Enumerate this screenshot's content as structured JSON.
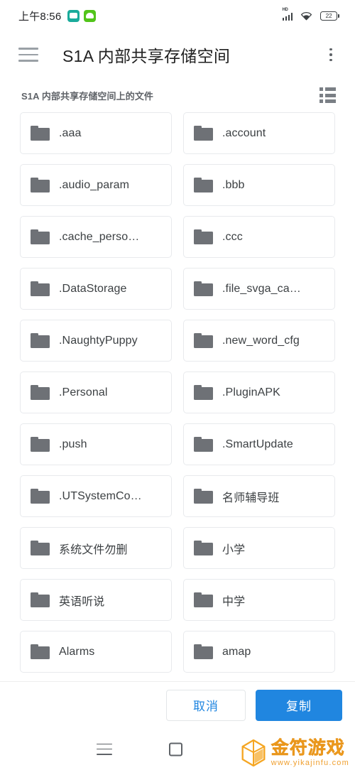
{
  "status_bar": {
    "time": "上午8:56",
    "app_icons": [
      "teal-app-icon",
      "green-app-icon"
    ],
    "network_label": "HD",
    "signal_icon": "signal-bars-icon",
    "wifi_icon": "wifi-icon",
    "battery_level": "22"
  },
  "app_bar": {
    "menu_icon": "hamburger-menu-icon",
    "title": "S1A 内部共享存储空间",
    "overflow_icon": "more-vertical-icon"
  },
  "sub_header": {
    "text": "S1A 内部共享存储空间上的文件",
    "view_toggle_icon": "list-view-icon"
  },
  "files": [
    {
      "name": ".aaa",
      "icon": "folder-icon"
    },
    {
      "name": ".account",
      "icon": "folder-icon"
    },
    {
      "name": ".audio_param",
      "icon": "folder-icon"
    },
    {
      "name": ".bbb",
      "icon": "folder-icon"
    },
    {
      "name": ".cache_perso…",
      "icon": "folder-icon"
    },
    {
      "name": ".ccc",
      "icon": "folder-icon"
    },
    {
      "name": ".DataStorage",
      "icon": "folder-icon"
    },
    {
      "name": ".file_svga_ca…",
      "icon": "folder-icon"
    },
    {
      "name": ".NaughtyPuppy",
      "icon": "folder-icon"
    },
    {
      "name": ".new_word_cfg",
      "icon": "folder-icon"
    },
    {
      "name": ".Personal",
      "icon": "folder-icon"
    },
    {
      "name": ".PluginAPK",
      "icon": "folder-icon"
    },
    {
      "name": ".push",
      "icon": "folder-icon"
    },
    {
      "name": ".SmartUpdate",
      "icon": "folder-icon"
    },
    {
      "name": ".UTSystemCo…",
      "icon": "folder-icon"
    },
    {
      "name": "名师辅导班",
      "icon": "folder-icon"
    },
    {
      "name": "系统文件勿删",
      "icon": "folder-icon"
    },
    {
      "name": "小学",
      "icon": "folder-icon"
    },
    {
      "name": "英语听说",
      "icon": "folder-icon"
    },
    {
      "name": "中学",
      "icon": "folder-icon"
    },
    {
      "name": "Alarms",
      "icon": "folder-icon"
    },
    {
      "name": "amap",
      "icon": "folder-icon"
    }
  ],
  "action_bar": {
    "cancel_label": "取消",
    "confirm_label": "复制",
    "accent_color": "#2086e0"
  },
  "nav_bar": {
    "recents_icon": "recents-menu-icon",
    "home_icon": "home-square-icon"
  },
  "watermark": {
    "title": "金符游戏",
    "url": "www.yikajinfu.com",
    "logo_icon": "cube-logo-icon",
    "color": "#f5a623"
  }
}
